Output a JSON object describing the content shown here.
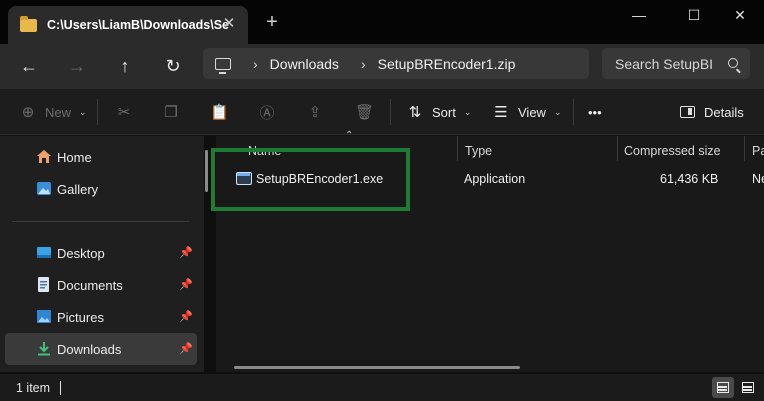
{
  "window": {
    "tab_title": "C:\\Users\\LiamB\\Downloads\\Se",
    "new_tab_label": "+",
    "minimize_label": "—",
    "maximize_label": "☐",
    "close_label": "✕"
  },
  "navigation": {
    "back_label": "←",
    "forward_label": "→",
    "up_label": "↑",
    "refresh_label": "↻",
    "breadcrumb": [
      "Downloads",
      "SetupBREncoder1.zip"
    ],
    "search_placeholder": "Search SetupBI"
  },
  "commands": {
    "new_label": "New",
    "sort_label": "Sort",
    "view_label": "View",
    "more_label": "•••",
    "details_label": "Details"
  },
  "sidebar": {
    "items": [
      {
        "label": "Home",
        "icon": "home-icon"
      },
      {
        "label": "Gallery",
        "icon": "gallery-icon"
      },
      {
        "label": "Desktop",
        "icon": "desktop-icon",
        "pinned": true
      },
      {
        "label": "Documents",
        "icon": "documents-icon",
        "pinned": true
      },
      {
        "label": "Pictures",
        "icon": "pictures-icon",
        "pinned": true
      },
      {
        "label": "Downloads",
        "icon": "downloads-icon",
        "pinned": true,
        "selected": true
      }
    ]
  },
  "file_list": {
    "columns": [
      "Name",
      "Type",
      "Compressed size",
      "Pa"
    ],
    "rows": [
      {
        "name": "SetupBREncoder1.exe",
        "type": "Application",
        "compressed_size": "61,436 KB",
        "password": "Ne"
      }
    ]
  },
  "status": {
    "item_count": "1 item"
  },
  "colors": {
    "highlight_box": "#1f7a34",
    "folder": "#e6b94a",
    "accent": "#6fb1ea"
  }
}
